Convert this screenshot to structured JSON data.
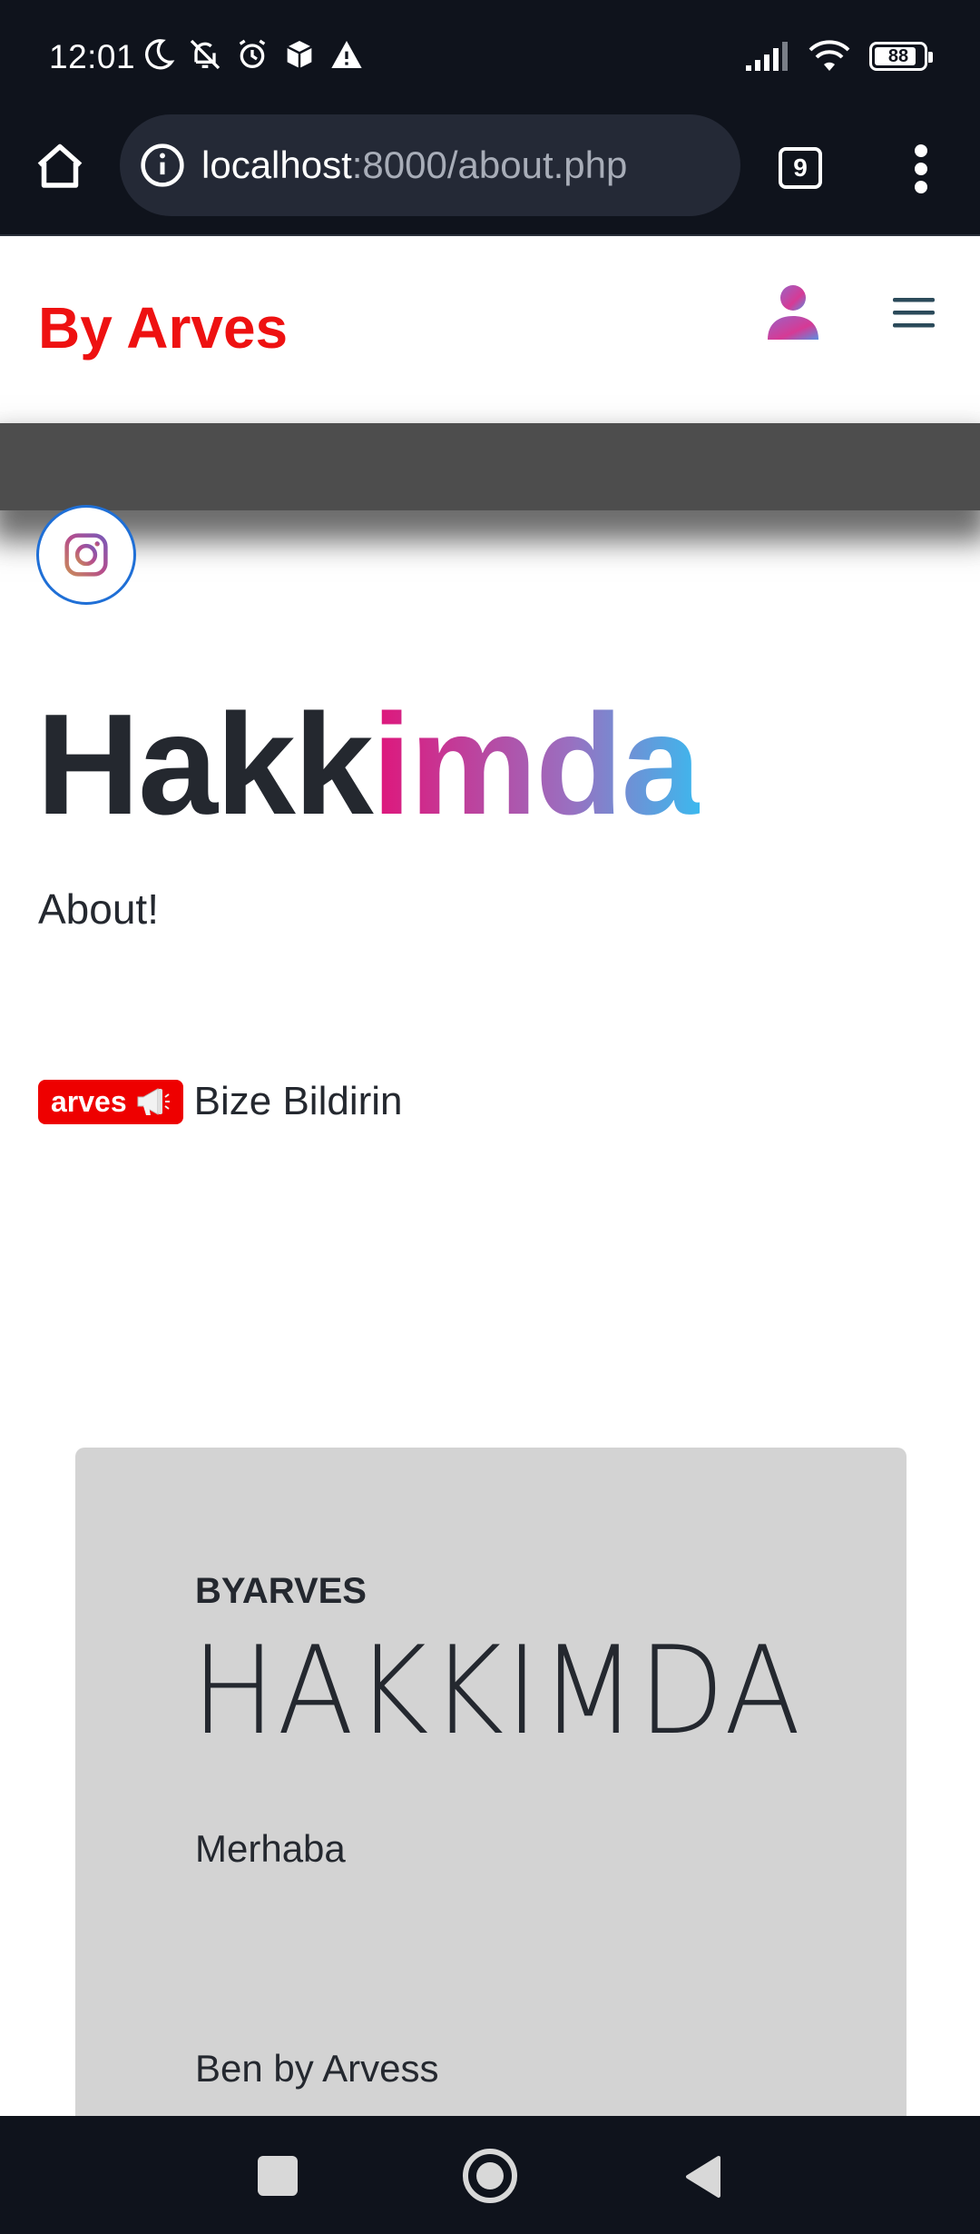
{
  "status_bar": {
    "time": "12:01",
    "battery": "88",
    "icons_left": [
      "moon-icon",
      "bell-off-icon",
      "alarm-icon",
      "package-icon",
      "warning-icon"
    ],
    "icons_right": [
      "signal-icon",
      "wifi-icon",
      "battery-icon"
    ]
  },
  "browser": {
    "url_host": "localhost",
    "url_rest": ":8000/about.php",
    "tab_count": "9"
  },
  "site": {
    "brand": "By Arves",
    "brand_color": "#ee1111"
  },
  "content": {
    "title_main": "Hakk",
    "title_accent": "imda",
    "subtitle": "About!",
    "badge_label": "arves",
    "notify_text": "Bize Bildirin"
  },
  "card": {
    "eyebrow": "BYARVES",
    "heading": "HAKKIMDA",
    "line1": "Merhaba",
    "line2": "Ben by Arvess"
  }
}
